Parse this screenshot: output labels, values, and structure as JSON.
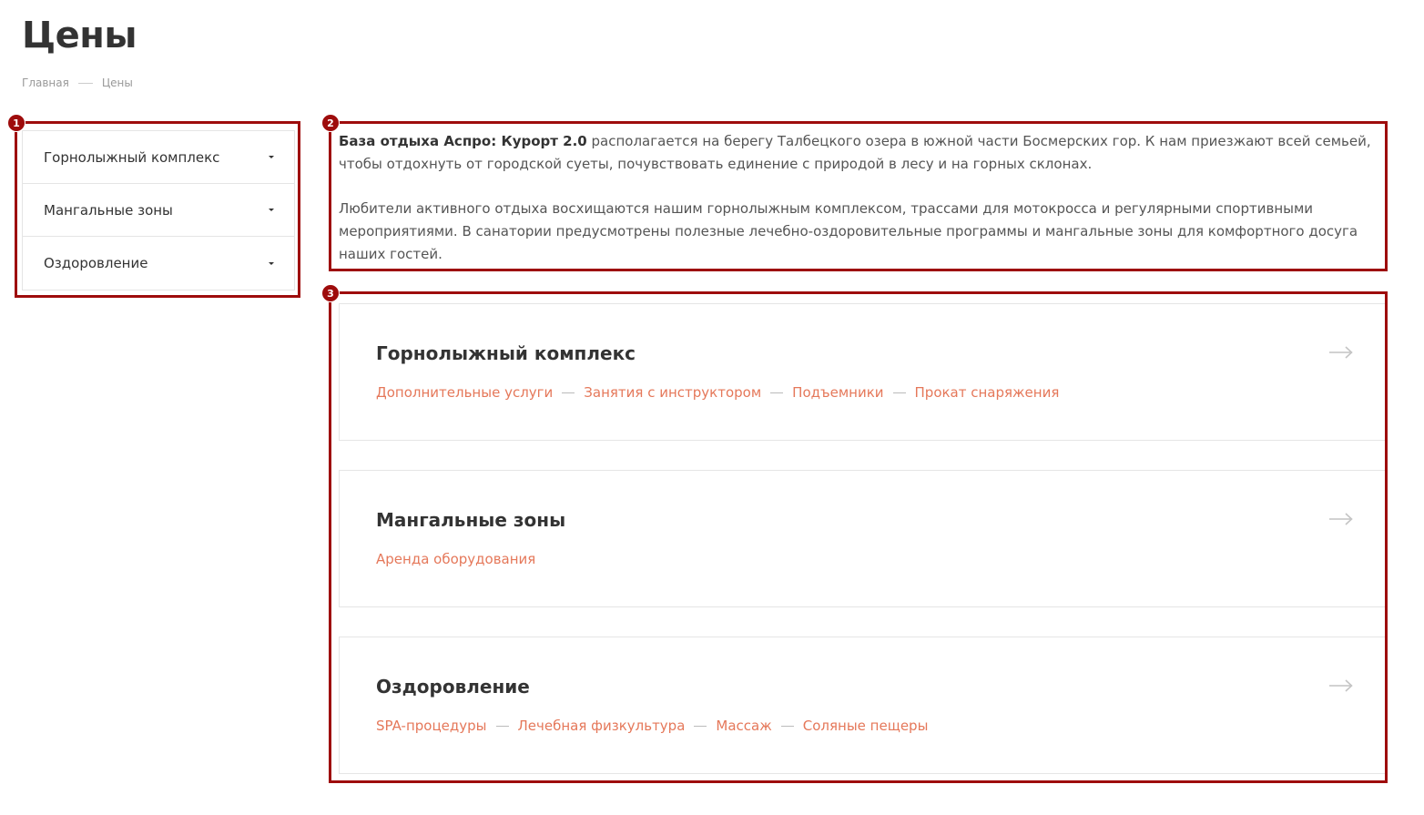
{
  "page": {
    "title": "Цены"
  },
  "breadcrumb": {
    "home": "Главная",
    "current": "Цены"
  },
  "badges": {
    "one": "1",
    "two": "2",
    "three": "3"
  },
  "sidebar": {
    "items": [
      {
        "label": "Горнолыжный комплекс"
      },
      {
        "label": "Мангальные зоны"
      },
      {
        "label": "Оздоровление"
      }
    ]
  },
  "intro": {
    "bold": "База отдыха Аспро: Курорт 2.0",
    "p1_rest": " располагается на берегу Талбецкого озера в южной части Босмерских гор. К нам приезжают всей семьей, чтобы отдохнуть от городской суеты, почувствовать единение с природой в лесу и на горных склонах.",
    "p2": "Любители активного отдыха восхищаются нашим горнолыжным комплексом, трассами для мотокросса и регулярными спортивными мероприятиями. В санатории предусмотрены полезные лечебно-оздоровительные программы и мангальные зоны для комфортного досуга наших гостей."
  },
  "cards": [
    {
      "title": "Горнолыжный комплекс",
      "links": [
        "Дополнительные услуги",
        "Занятия с инструктором",
        "Подъемники",
        "Прокат снаряжения"
      ]
    },
    {
      "title": "Мангальные зоны",
      "links": [
        "Аренда оборудования"
      ]
    },
    {
      "title": "Оздоровление",
      "links": [
        "SPA-процедуры",
        "Лечебная физкультура",
        "Массаж",
        "Соляные пещеры"
      ]
    }
  ],
  "colors": {
    "accent": "#e5785a",
    "annotation": "#9e0c0c",
    "text": "#333333"
  }
}
